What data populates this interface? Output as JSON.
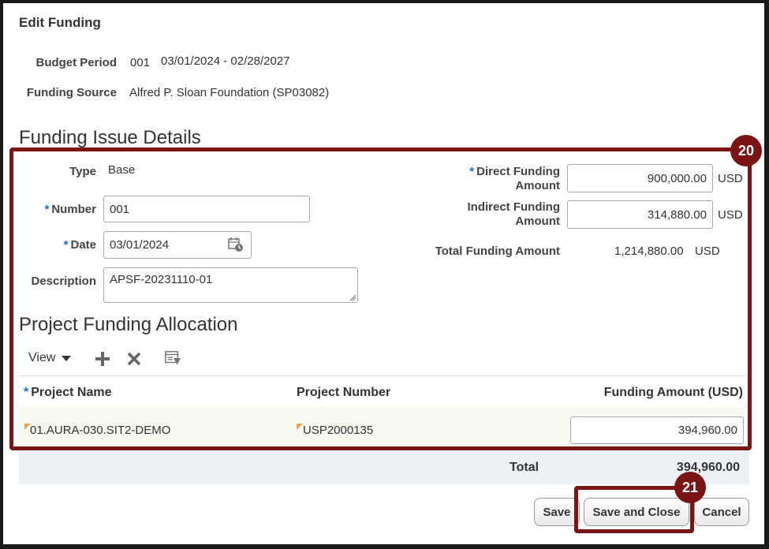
{
  "page": {
    "title": "Edit Funding"
  },
  "header": {
    "budget_period_label": "Budget Period",
    "budget_period_number": "001",
    "budget_period_range": "03/01/2024 - 02/28/2027",
    "funding_source_label": "Funding Source",
    "funding_source_value": "Alfred P. Sloan Foundation (SP03082)"
  },
  "funding_issue": {
    "heading": "Funding Issue Details",
    "type_label": "Type",
    "type_value": "Base",
    "number_label": "Number",
    "number_value": "001",
    "date_label": "Date",
    "date_value": "03/01/2024",
    "description_label": "Description",
    "description_value": "APSF-20231110-01",
    "direct_label_1": "Direct Funding",
    "direct_label_2": "Amount",
    "direct_value": "900,000.00",
    "indirect_label_1": "Indirect Funding",
    "indirect_label_2": "Amount",
    "indirect_value": "314,880.00",
    "currency": "USD",
    "total_label": "Total Funding Amount",
    "total_value": "1,214,880.00",
    "total_currency": "USD"
  },
  "allocation": {
    "heading": "Project Funding Allocation",
    "view_label": "View",
    "icons": [
      "add-icon",
      "delete-icon",
      "freeze-columns-icon",
      "chevron-down-icon",
      "calendar-icon"
    ],
    "columns": [
      "Project Name",
      "Project Number",
      "Funding Amount (USD)"
    ],
    "rows": [
      {
        "project_name": "01.AURA-030.SIT2-DEMO",
        "project_number": "USP2000135",
        "funding_amount": "394,960.00"
      }
    ],
    "total_label": "Total",
    "total_value": "394,960.00"
  },
  "buttons": {
    "save": "Save",
    "save_close": "Save and Close",
    "cancel": "Cancel"
  },
  "annotations": {
    "badge_20": "20",
    "badge_21": "21",
    "color": "#7a1515"
  }
}
